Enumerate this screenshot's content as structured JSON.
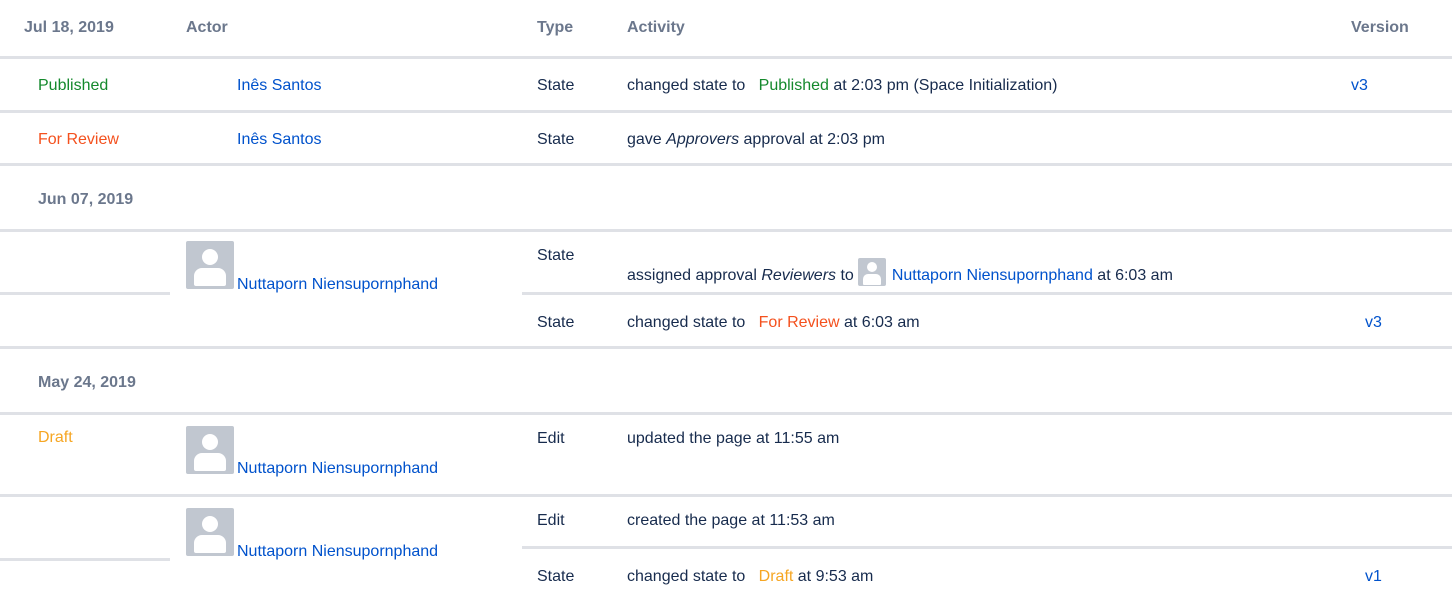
{
  "header": {
    "date": "Jul 18, 2019",
    "actor": "Actor",
    "type": "Type",
    "activity": "Activity",
    "version": "Version"
  },
  "groups": [
    {
      "date": "Jul 18, 2019",
      "rows": [
        {
          "state": "Published",
          "actor": "Inês Santos",
          "type": "State",
          "activity_prefix": "changed state to",
          "activity_state": "Published",
          "activity_suffix": "at 2:03 pm (Space Initialization)",
          "version": "v3"
        },
        {
          "state": "For Review",
          "actor": "Inês Santos",
          "type": "State",
          "activity_prefix": "gave",
          "activity_em": "Approvers",
          "activity_suffix": "approval at 2:03 pm",
          "version": ""
        }
      ]
    },
    {
      "date": "Jun 07, 2019",
      "rows": [
        {
          "state": "",
          "actor": "Nuttaporn Niensupornphand",
          "type": "State",
          "activity_prefix": "assigned approval",
          "activity_em": "Reviewers",
          "activity_to": "to",
          "activity_user": "Nuttaporn Niensupornphand",
          "activity_suffix": "at 6:03 am",
          "version": ""
        },
        {
          "state": "",
          "actor": "",
          "type": "State",
          "activity_prefix": "changed state to",
          "activity_state": "For Review",
          "activity_suffix": "at 6:03 am",
          "version": "v3"
        }
      ]
    },
    {
      "date": "May 24, 2019",
      "rows": [
        {
          "state": "Draft",
          "actor": "Nuttaporn Niensupornphand",
          "type": "Edit",
          "activity": "updated the page at 11:55 am",
          "version": ""
        },
        {
          "state": "",
          "actor": "Nuttaporn Niensupornphand",
          "type": "Edit",
          "activity": "created the page at 11:53 am",
          "version": ""
        },
        {
          "state": "",
          "actor": "",
          "type": "State",
          "activity_prefix": "changed state to",
          "activity_state": "Draft",
          "activity_suffix": "at 9:53 am",
          "version": "v1"
        }
      ]
    }
  ],
  "colors": {
    "link": "#0052cc",
    "published": "#14892c",
    "for_review": "#f4511e",
    "draft": "#f6a623",
    "header_text": "#6b778c",
    "divider": "#dfe1e6"
  },
  "icons": {
    "avatar": "default-user-avatar-icon"
  }
}
